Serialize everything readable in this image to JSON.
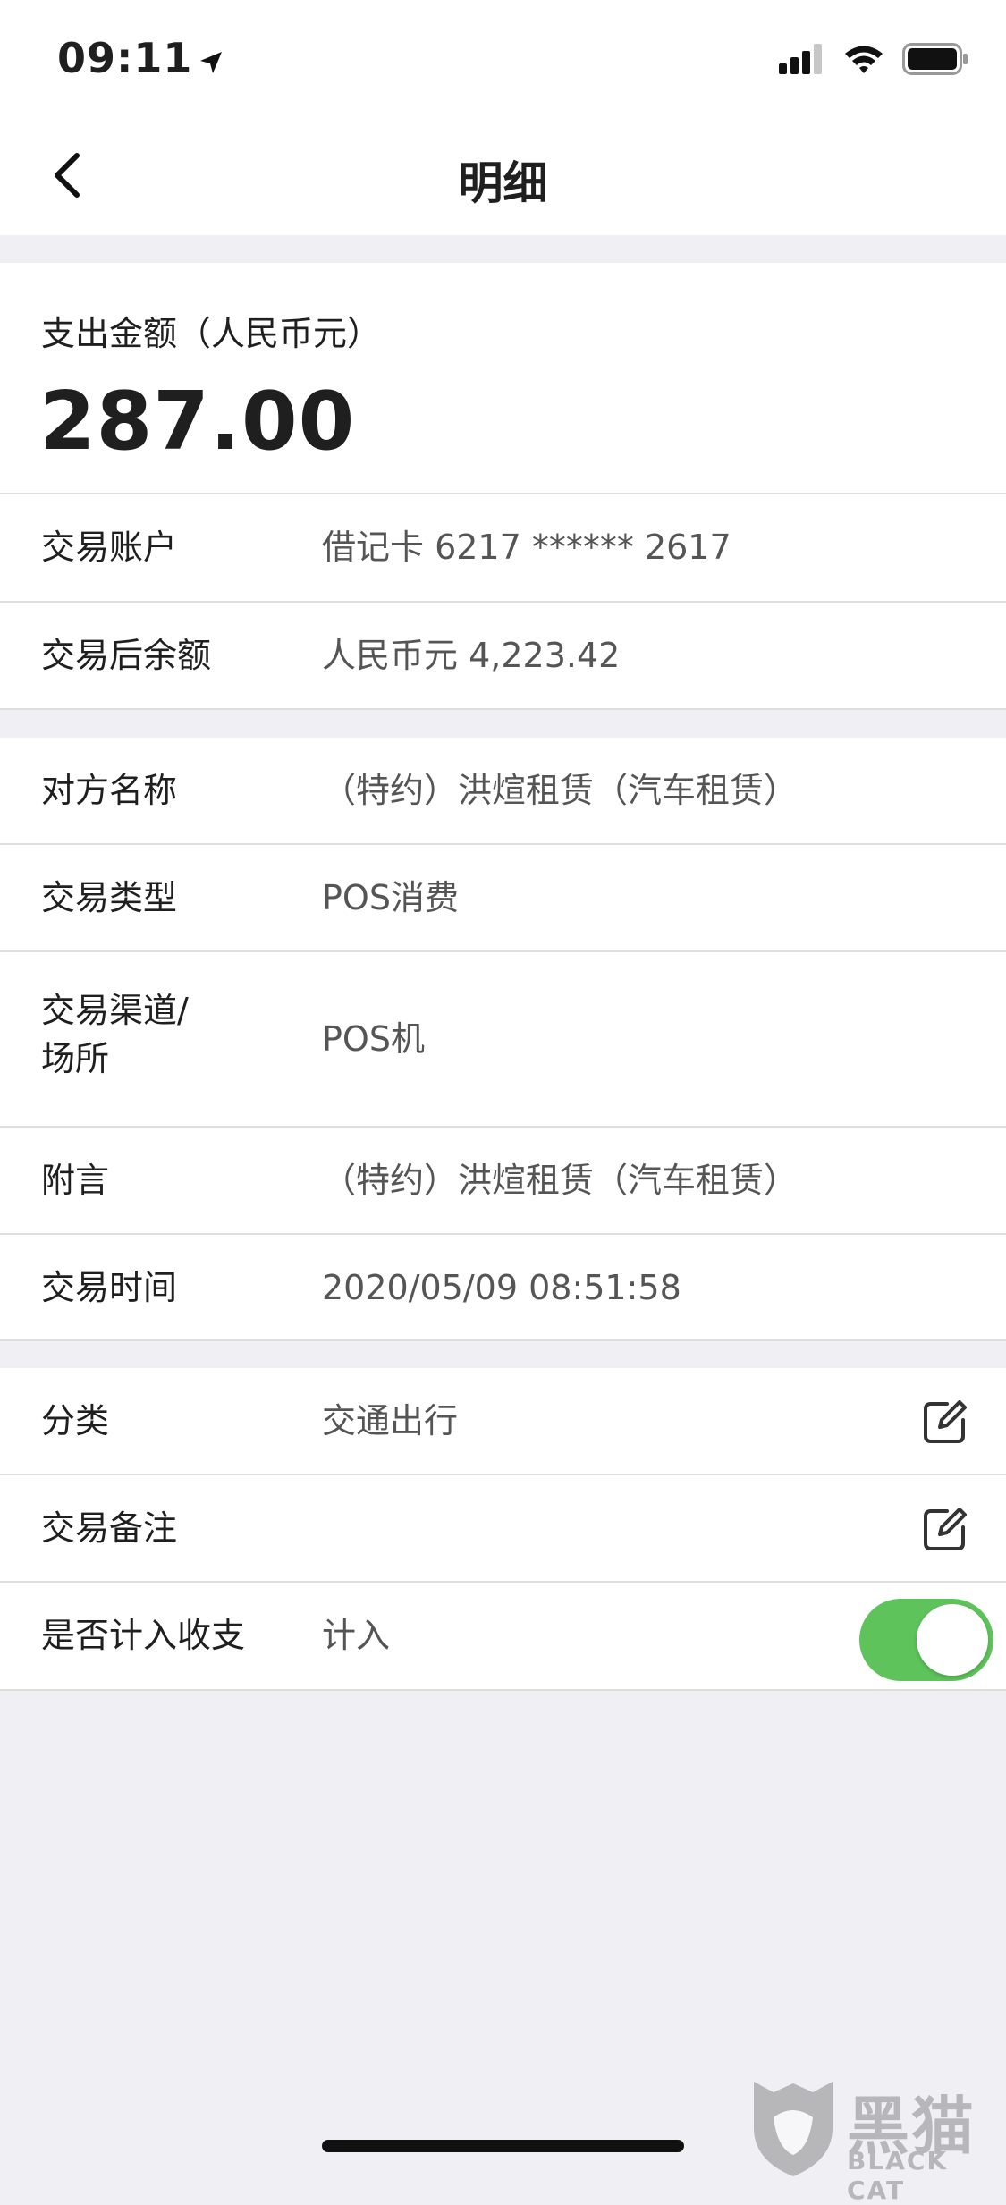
{
  "status": {
    "time": "09:11"
  },
  "header": {
    "title": "明细"
  },
  "amount": {
    "label": "支出金额（人民币元）",
    "value": "287.00"
  },
  "account_rows": [
    {
      "label": "交易账户",
      "value": "借记卡 6217 ****** 2617"
    },
    {
      "label": "交易后余额",
      "value": "人民币元 4,223.42"
    }
  ],
  "detail_rows": [
    {
      "label": "对方名称",
      "value": "（特约）洪煊租赁（汽车租赁）"
    },
    {
      "label": "交易类型",
      "value": "POS消费"
    },
    {
      "label": "交易渠道/",
      "label2": "场所",
      "value": "POS机"
    },
    {
      "label": "附言",
      "value": "（特约）洪煊租赁（汽车租赁）"
    },
    {
      "label": "交易时间",
      "value": "2020/05/09  08:51:58"
    }
  ],
  "category_rows": [
    {
      "label": "分类",
      "value": "交通出行"
    },
    {
      "label": "交易备注",
      "value": ""
    },
    {
      "label": "是否计入收支",
      "value": "计入",
      "toggle_on": true
    }
  ],
  "watermark": {
    "big": "黑猫",
    "small": "BLACK CAT"
  },
  "colors": {
    "toggle_on": "#5ec35b",
    "background": "#efeff4"
  }
}
